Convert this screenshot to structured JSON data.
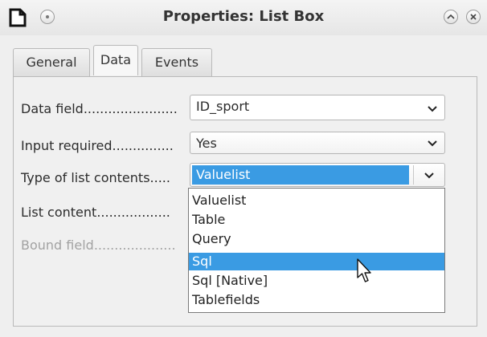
{
  "window": {
    "title": "Properties: List Box"
  },
  "titlebar": {
    "app_icon": "document-icon",
    "menu_button": "circle-button-icon",
    "shade_button": "chevron-up-icon",
    "close_button": "close-icon"
  },
  "tabs": [
    {
      "label": "General",
      "active": false
    },
    {
      "label": "Data",
      "active": true
    },
    {
      "label": "Events",
      "active": false
    }
  ],
  "fields": {
    "data_field": {
      "label": "Data field.......................",
      "value": "ID_sport"
    },
    "input_required": {
      "label": "Input required...............",
      "value": "Yes"
    },
    "type_of_list_contents": {
      "label": "Type of list contents.....",
      "value": "Valuelist"
    },
    "list_content": {
      "label": "List content.................."
    },
    "bound_field": {
      "label": "Bound field....................",
      "disabled": true
    }
  },
  "dropdown": {
    "options": [
      "Valuelist",
      "Table",
      "Query",
      "Sql",
      "Sql [Native]",
      "Tablefields"
    ],
    "highlighted": "Sql"
  },
  "colors": {
    "selection": "#3a9be3",
    "window_bg": "#efefef"
  }
}
